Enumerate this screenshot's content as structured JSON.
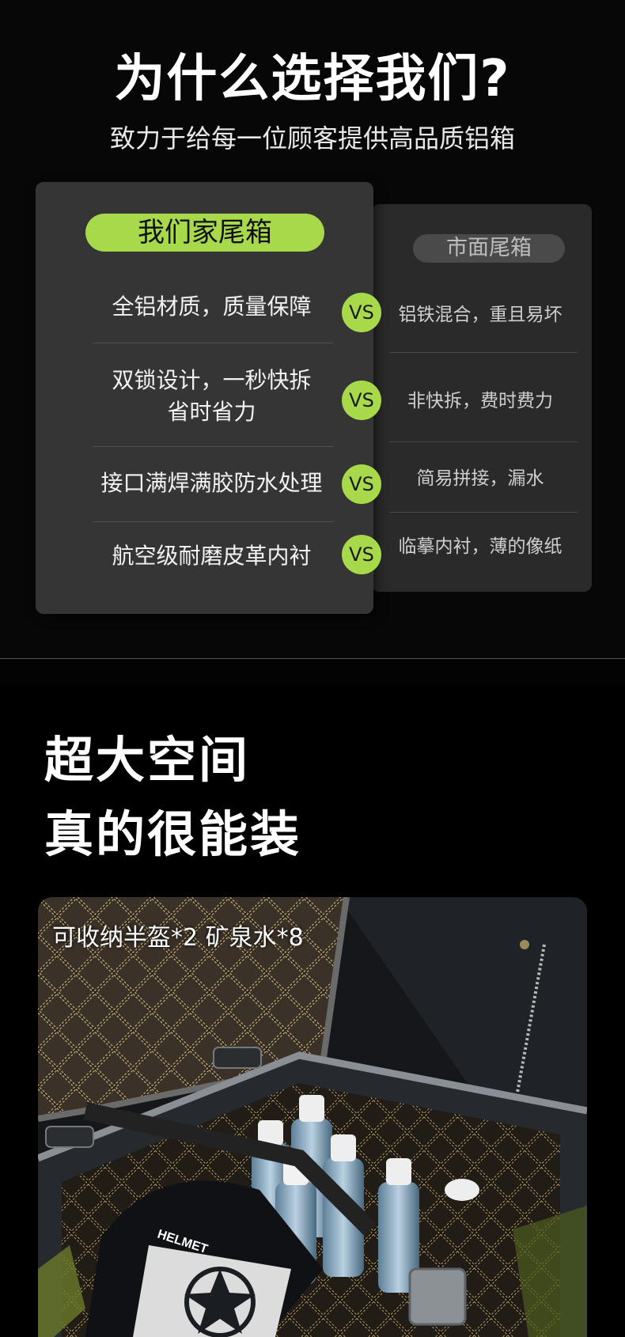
{
  "header": {
    "title": "为什么选择我们?",
    "subtitle": "致力于给每一位顾客提供高品质铝箱"
  },
  "comparison": {
    "ours_label": "我们家尾箱",
    "market_label": "市面尾箱",
    "vs_label": "VS",
    "rows": [
      {
        "ours_line1": "全铝材质，质量保障",
        "ours_line2": "",
        "market": "铝铁混合，重且易坏"
      },
      {
        "ours_line1": "双锁设计，一秒快拆",
        "ours_line2": "省时省力",
        "market": "非快拆，费时费力"
      },
      {
        "ours_line1": "接口满焊满胶防水处理",
        "ours_line2": "",
        "market": "简易拼接，漏水"
      },
      {
        "ours_line1": "航空级耐磨皮革内衬",
        "ours_line2": "",
        "market": "临摹内衬，薄的像纸"
      }
    ]
  },
  "space": {
    "line1": "超大空间",
    "line2": "真的很能装",
    "caption": "可收纳半盔*2 矿泉水*8",
    "helmet_text": "HELMET"
  },
  "colors": {
    "accent_green": "#a7d94b",
    "background": "#000000"
  }
}
